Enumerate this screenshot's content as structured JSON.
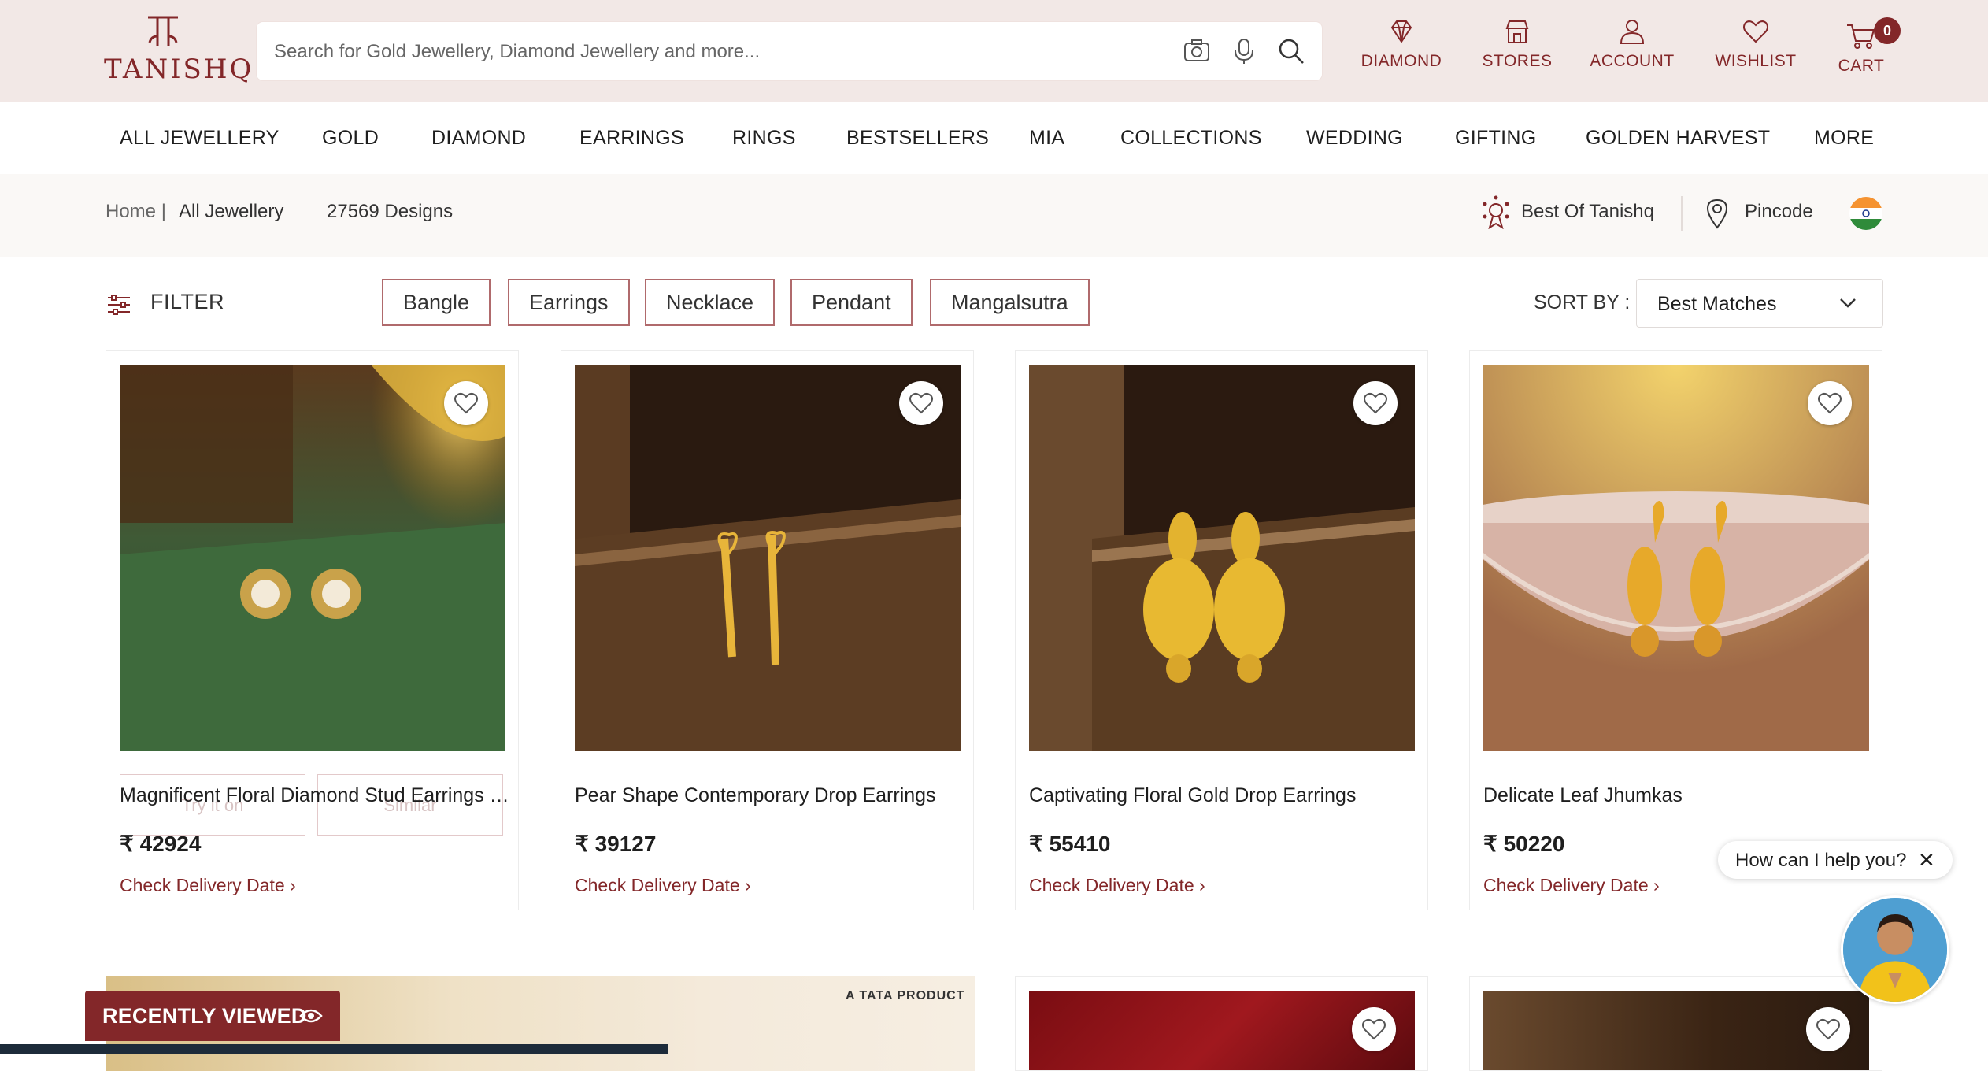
{
  "header": {
    "brand": "TANISHQ",
    "search_placeholder": "Search for Gold Jewellery, Diamond Jewellery and more...",
    "diamond_label": "DIAMOND",
    "stores_label": "STORES",
    "account_label": "ACCOUNT",
    "wishlist_label": "WISHLIST",
    "cart_label": "CART",
    "cart_count": "0"
  },
  "nav": {
    "items": [
      "ALL JEWELLERY",
      "GOLD",
      "DIAMOND",
      "EARRINGS",
      "RINGS",
      "BESTSELLERS",
      "MIA",
      "COLLECTIONS",
      "WEDDING",
      "GIFTING",
      "GOLDEN HARVEST",
      "MORE"
    ]
  },
  "breadcrumb": {
    "home": "Home |",
    "current": "All Jewellery",
    "count": "27569 Designs",
    "best_of": "Best Of Tanishq",
    "pincode": "Pincode"
  },
  "filter": {
    "label": "FILTER",
    "chips": [
      "Bangle",
      "Earrings",
      "Necklace",
      "Pendant",
      "Mangalsutra"
    ],
    "sort_label": "SORT BY :",
    "sort_value": "Best Matches"
  },
  "products": [
    {
      "title": "Magnificent Floral Diamond Stud Earrings i...",
      "price": "₹ 42924",
      "delivery": "Check Delivery Date"
    },
    {
      "title": "Pear Shape Contemporary Drop Earrings",
      "price": "₹ 39127",
      "delivery": "Check Delivery Date"
    },
    {
      "title": "Captivating Floral Gold Drop Earrings",
      "price": "₹ 55410",
      "delivery": "Check Delivery Date"
    },
    {
      "title": "Delicate Leaf Jhumkas",
      "price": "₹ 50220",
      "delivery": "Check Delivery Date"
    }
  ],
  "card_actions": {
    "try_label": "Try it on",
    "similar_label": "Similar"
  },
  "banner": {
    "tag": "A TATA PRODUCT"
  },
  "recently_viewed": "RECENTLY VIEWED",
  "chat": {
    "prompt": "How can I help you?",
    "close": "✕"
  },
  "colors": {
    "brand": "#832729",
    "header_bg": "#f2e8e6",
    "crumb_bg": "#faf8f6"
  }
}
